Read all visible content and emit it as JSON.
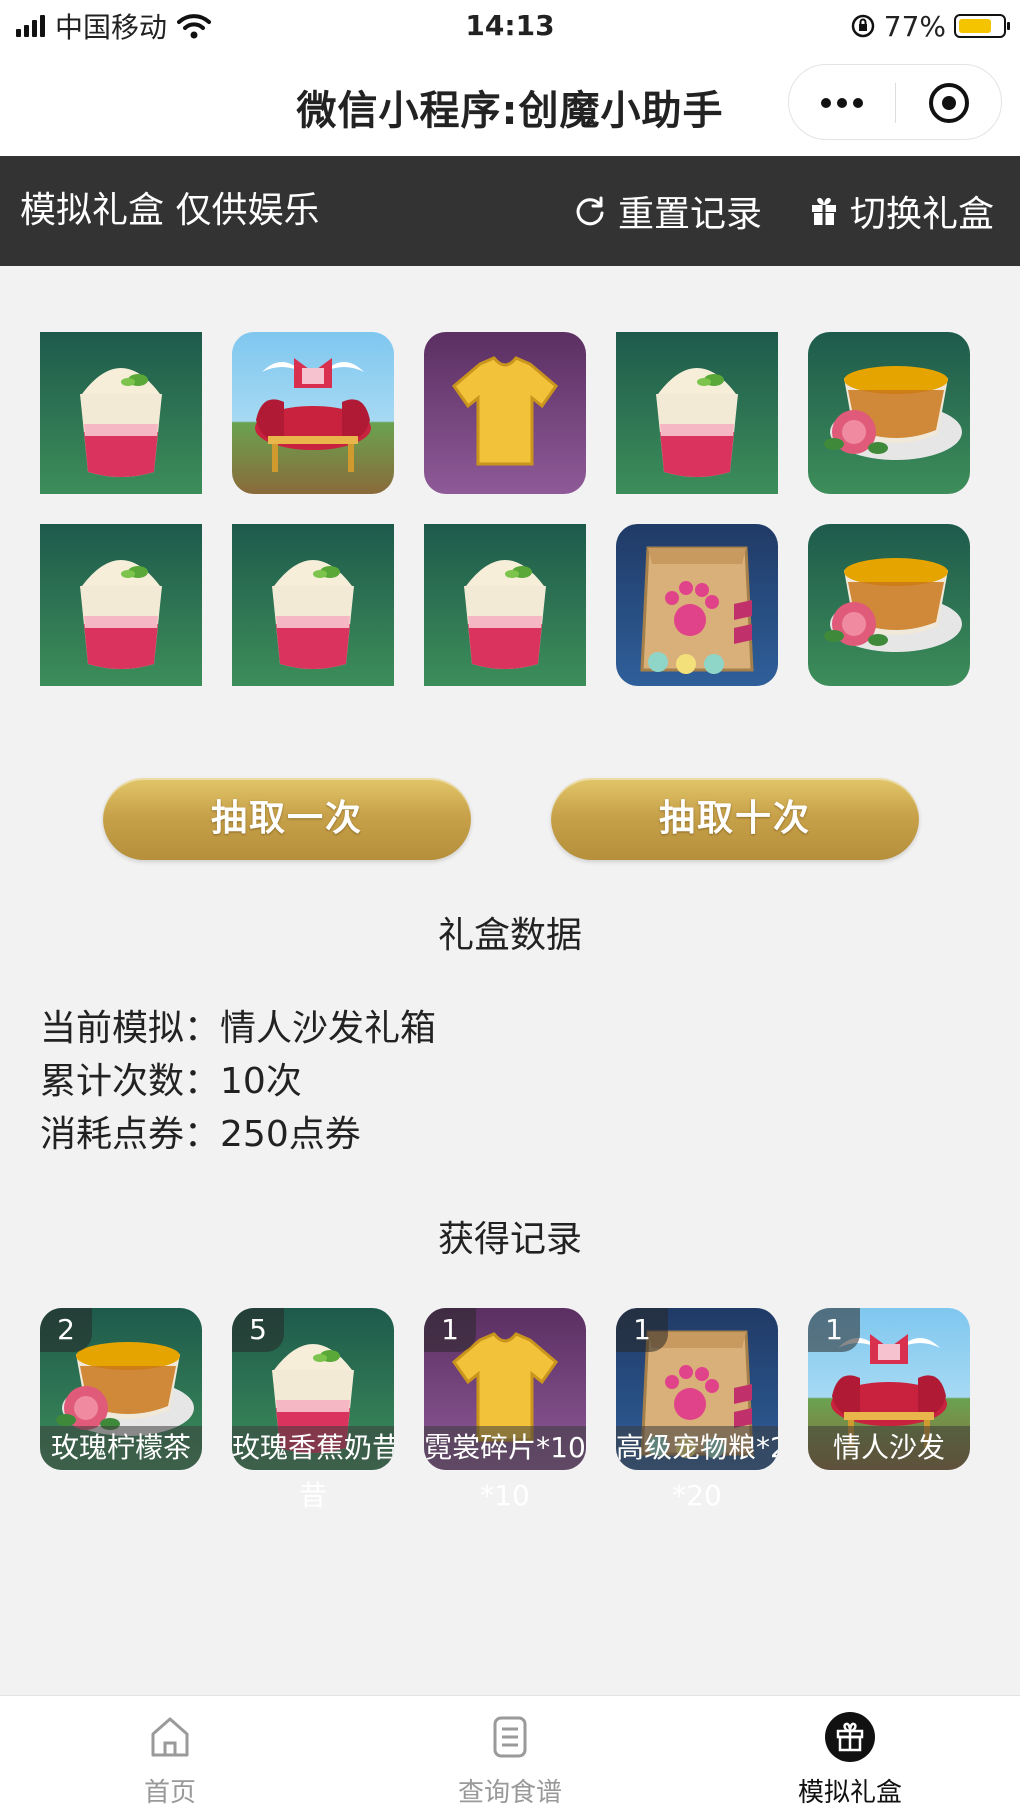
{
  "status_bar": {
    "carrier": "中国移动",
    "time": "14:13",
    "battery": "77%",
    "battery_level": 0.77
  },
  "title_bar": {
    "title": "微信小程序:创魔小助手"
  },
  "toolbar": {
    "title": "模拟礼盒 仅供娱乐",
    "reset_label": "重置记录",
    "switch_label": "切换礼盒"
  },
  "draw_results": [
    "milkshake",
    "love-sofa",
    "shirt-shard",
    "milkshake",
    "rose-tea",
    "milkshake",
    "milkshake",
    "milkshake",
    "pet-food",
    "rose-tea"
  ],
  "buttons": {
    "draw_once": "抽取一次",
    "draw_ten": "抽取十次"
  },
  "box_data": {
    "heading": "礼盒数据",
    "current_label": "当前模拟：",
    "current_value": "情人沙发礼箱",
    "count_label": "累计次数：",
    "count_value": "10次",
    "cost_label": "消耗点券：",
    "cost_value": "250点券"
  },
  "records": {
    "heading": "获得记录",
    "items": [
      {
        "count": "2",
        "name": "玫瑰柠檬茶",
        "icon": "rose-tea",
        "overflow": ""
      },
      {
        "count": "5",
        "name": "玫瑰香蕉奶昔",
        "icon": "milkshake",
        "overflow": "昔"
      },
      {
        "count": "1",
        "name": "霓裳碎片*10",
        "icon": "shirt-shard",
        "overflow": "*10"
      },
      {
        "count": "1",
        "name": "高级宠物粮*20",
        "icon": "pet-food",
        "overflow": "*20"
      },
      {
        "count": "1",
        "name": "情人沙发",
        "icon": "love-sofa",
        "overflow": ""
      }
    ]
  },
  "tabs": [
    {
      "label": "首页",
      "icon": "home-icon",
      "active": false
    },
    {
      "label": "查询食谱",
      "icon": "recipe-icon",
      "active": false
    },
    {
      "label": "模拟礼盒",
      "icon": "gift-icon",
      "active": true
    }
  ]
}
